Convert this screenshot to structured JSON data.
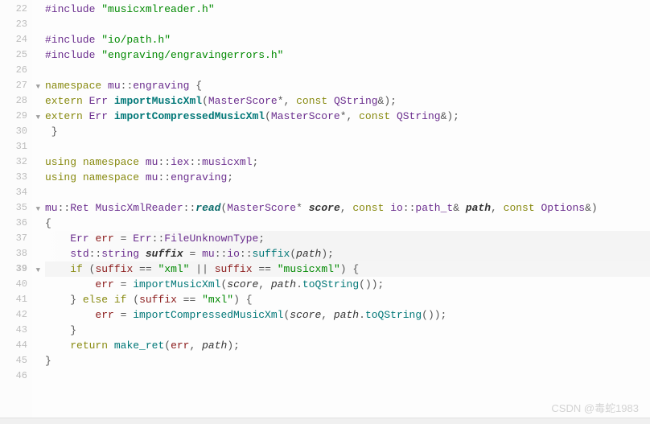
{
  "gutter": {
    "start": 22,
    "end": 46,
    "current": 39,
    "folds": [
      27,
      29,
      35,
      39
    ]
  },
  "lines": {
    "22": [
      [
        "pp",
        "#include "
      ],
      [
        "str",
        "\"musicxmlreader.h\""
      ]
    ],
    "23": [],
    "24": [
      [
        "pp",
        "#include "
      ],
      [
        "str",
        "\"io/path.h\""
      ]
    ],
    "25": [
      [
        "pp",
        "#include "
      ],
      [
        "str",
        "\"engraving/engravingerrors.h\""
      ]
    ],
    "26": [],
    "27": [
      [
        "kw",
        "namespace"
      ],
      [
        "pl",
        " "
      ],
      [
        "typ",
        "mu"
      ],
      [
        "pl",
        "::"
      ],
      [
        "typ",
        "engraving"
      ],
      [
        "pl",
        " {"
      ]
    ],
    "28": [
      [
        "kw",
        "extern"
      ],
      [
        "pl",
        " "
      ],
      [
        "typ",
        "Err"
      ],
      [
        "pl",
        " "
      ],
      [
        "fnb",
        "importMusicXml"
      ],
      [
        "pl",
        "("
      ],
      [
        "typ",
        "MasterScore"
      ],
      [
        "pl",
        "*, "
      ],
      [
        "kw",
        "const"
      ],
      [
        "pl",
        " "
      ],
      [
        "typ",
        "QString"
      ],
      [
        "pl",
        "&);"
      ]
    ],
    "29": [
      [
        "kw",
        "extern"
      ],
      [
        "pl",
        " "
      ],
      [
        "typ",
        "Err"
      ],
      [
        "pl",
        " "
      ],
      [
        "fnb",
        "importCompressedMusicXml"
      ],
      [
        "pl",
        "("
      ],
      [
        "typ",
        "MasterScore"
      ],
      [
        "pl",
        "*, "
      ],
      [
        "kw",
        "const"
      ],
      [
        "pl",
        " "
      ],
      [
        "typ",
        "QString"
      ],
      [
        "pl",
        "&);"
      ]
    ],
    "30": [
      [
        "pl",
        " }"
      ]
    ],
    "31": [],
    "32": [
      [
        "kw",
        "using"
      ],
      [
        "pl",
        " "
      ],
      [
        "kw",
        "namespace"
      ],
      [
        "pl",
        " "
      ],
      [
        "typ",
        "mu"
      ],
      [
        "pl",
        "::"
      ],
      [
        "typ",
        "iex"
      ],
      [
        "pl",
        "::"
      ],
      [
        "typ",
        "musicxml"
      ],
      [
        "pl",
        ";"
      ]
    ],
    "33": [
      [
        "kw",
        "using"
      ],
      [
        "pl",
        " "
      ],
      [
        "kw",
        "namespace"
      ],
      [
        "pl",
        " "
      ],
      [
        "typ",
        "mu"
      ],
      [
        "pl",
        "::"
      ],
      [
        "typ",
        "engraving"
      ],
      [
        "pl",
        ";"
      ]
    ],
    "34": [],
    "35": [
      [
        "typ",
        "mu"
      ],
      [
        "pl",
        "::"
      ],
      [
        "typ",
        "Ret"
      ],
      [
        "pl",
        " "
      ],
      [
        "typ",
        "MusicXmlReader"
      ],
      [
        "pl",
        "::"
      ],
      [
        "fnbi",
        "read"
      ],
      [
        "pl",
        "("
      ],
      [
        "typ",
        "MasterScore"
      ],
      [
        "pl",
        "* "
      ],
      [
        "argb",
        "score"
      ],
      [
        "pl",
        ", "
      ],
      [
        "kw",
        "const"
      ],
      [
        "pl",
        " "
      ],
      [
        "typ",
        "io"
      ],
      [
        "pl",
        "::"
      ],
      [
        "typ",
        "path_t"
      ],
      [
        "pl",
        "& "
      ],
      [
        "argb",
        "path"
      ],
      [
        "pl",
        ", "
      ],
      [
        "kw",
        "const"
      ],
      [
        "pl",
        " "
      ],
      [
        "typ",
        "Options"
      ],
      [
        "pl",
        "&)"
      ]
    ],
    "36": [
      [
        "pl",
        "{"
      ]
    ],
    "37": [
      [
        "pl",
        "    "
      ],
      [
        "typ",
        "Err"
      ],
      [
        "pl",
        " "
      ],
      [
        "id",
        "err"
      ],
      [
        "pl",
        " = "
      ],
      [
        "typ",
        "Err"
      ],
      [
        "pl",
        "::"
      ],
      [
        "typ",
        "FileUnknownType"
      ],
      [
        "pl",
        ";"
      ]
    ],
    "38": [
      [
        "pl",
        "    "
      ],
      [
        "typ",
        "std"
      ],
      [
        "pl",
        "::"
      ],
      [
        "typ",
        "string"
      ],
      [
        "pl",
        " "
      ],
      [
        "argb",
        "suffix"
      ],
      [
        "pl",
        " = "
      ],
      [
        "typ",
        "mu"
      ],
      [
        "pl",
        "::"
      ],
      [
        "typ",
        "io"
      ],
      [
        "pl",
        "::"
      ],
      [
        "fn",
        "suffix"
      ],
      [
        "pl",
        "("
      ],
      [
        "arg",
        "path"
      ],
      [
        "pl",
        ");"
      ]
    ],
    "39": [
      [
        "pl",
        "    "
      ],
      [
        "kw",
        "if"
      ],
      [
        "pl",
        " ("
      ],
      [
        "id",
        "suffix"
      ],
      [
        "pl",
        " == "
      ],
      [
        "str",
        "\"xml\""
      ],
      [
        "pl",
        " || "
      ],
      [
        "id",
        "suffix"
      ],
      [
        "pl",
        " == "
      ],
      [
        "str",
        "\"musicxml\""
      ],
      [
        "pl",
        ") {"
      ]
    ],
    "40": [
      [
        "pl",
        "        "
      ],
      [
        "id",
        "err"
      ],
      [
        "pl",
        " = "
      ],
      [
        "fn",
        "importMusicXml"
      ],
      [
        "pl",
        "("
      ],
      [
        "arg",
        "score"
      ],
      [
        "pl",
        ", "
      ],
      [
        "arg",
        "path"
      ],
      [
        "pl",
        "."
      ],
      [
        "fn",
        "toQString"
      ],
      [
        "pl",
        "());"
      ]
    ],
    "41": [
      [
        "pl",
        "    } "
      ],
      [
        "kw",
        "else"
      ],
      [
        "pl",
        " "
      ],
      [
        "kw",
        "if"
      ],
      [
        "pl",
        " ("
      ],
      [
        "id",
        "suffix"
      ],
      [
        "pl",
        " == "
      ],
      [
        "str",
        "\"mxl\""
      ],
      [
        "pl",
        ") {"
      ]
    ],
    "42": [
      [
        "pl",
        "        "
      ],
      [
        "id",
        "err"
      ],
      [
        "pl",
        " = "
      ],
      [
        "fn",
        "importCompressedMusicXml"
      ],
      [
        "pl",
        "("
      ],
      [
        "arg",
        "score"
      ],
      [
        "pl",
        ", "
      ],
      [
        "arg",
        "path"
      ],
      [
        "pl",
        "."
      ],
      [
        "fn",
        "toQString"
      ],
      [
        "pl",
        "());"
      ]
    ],
    "43": [
      [
        "pl",
        "    }"
      ]
    ],
    "44": [
      [
        "pl",
        "    "
      ],
      [
        "kw",
        "return"
      ],
      [
        "pl",
        " "
      ],
      [
        "fn",
        "make_ret"
      ],
      [
        "pl",
        "("
      ],
      [
        "id",
        "err"
      ],
      [
        "pl",
        ", "
      ],
      [
        "arg",
        "path"
      ],
      [
        "pl",
        ");"
      ]
    ],
    "45": [
      [
        "pl",
        "}"
      ]
    ],
    "46": []
  },
  "highlight_lines": [
    37,
    38
  ],
  "watermark": "CSDN @毒蛇1983"
}
